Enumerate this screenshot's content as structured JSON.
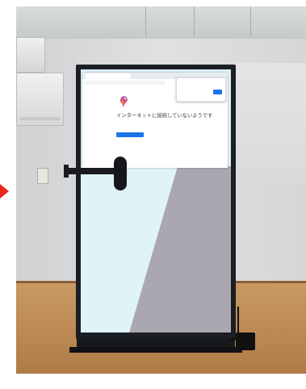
{
  "screen": {
    "tab_title": "",
    "address": "",
    "error_title": "インターネットに接続していないようです",
    "error_sub": "",
    "error_hint": "",
    "reload_label": "",
    "details_link": "",
    "notice_title": "",
    "notice_body": ""
  },
  "colors": {
    "arrow": "#e8271b",
    "button_blue": "#1a73e8",
    "screen_cyan": "#ddf1f8",
    "screen_gray": "#aaa7b0",
    "table": "#b8844f"
  },
  "icons": {
    "arrow": "right-pointing-triangle-icon",
    "dino": "colorful-sprite-icon"
  }
}
